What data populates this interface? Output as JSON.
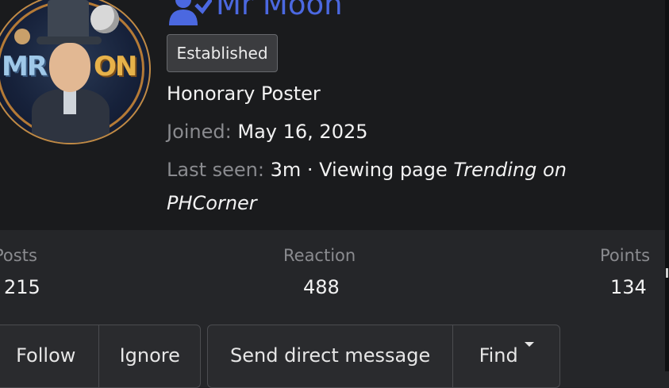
{
  "profile": {
    "name": "Mr Moon",
    "avatar_text_left": "MR",
    "avatar_text_right": "ON",
    "badge": "Established",
    "user_title": "Honorary Poster",
    "joined_label": "Joined:",
    "joined_value": "May 16, 2025",
    "last_seen_label": "Last seen:",
    "last_seen_value": "3m · Viewing page",
    "last_seen_page": "Trending on",
    "last_seen_page_cont": "PHCorner"
  },
  "stats": {
    "posts_label": "Posts",
    "posts_value": "215",
    "reaction_label": "Reaction",
    "reaction_value": "488",
    "points_label": "Points",
    "points_value": "134"
  },
  "actions": {
    "follow": "Follow",
    "ignore": "Ignore",
    "send_message": "Send direct message",
    "find": "Find"
  },
  "colors": {
    "name": "#4b68e0",
    "header_bg": "#1a1b1d",
    "page_bg": "#252629"
  }
}
